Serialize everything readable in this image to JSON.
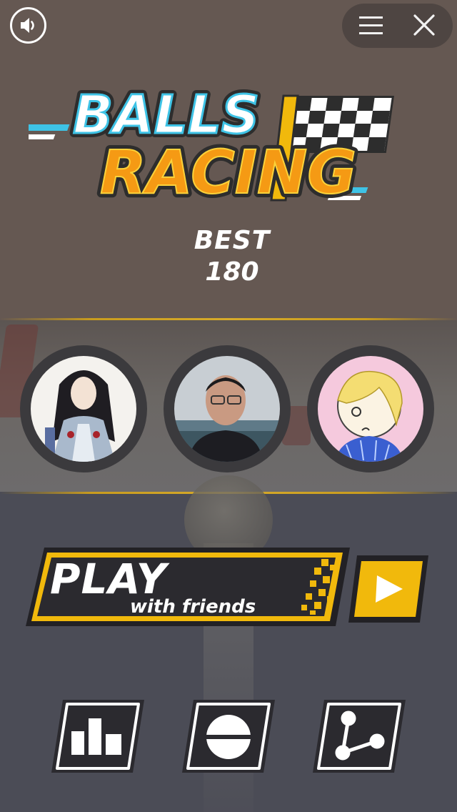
{
  "game": {
    "logo_line1": "BALLS",
    "logo_line2": "RACING"
  },
  "best": {
    "label": "BEST",
    "score": "180"
  },
  "play": {
    "title": "PLAY",
    "subtitle": "with friends"
  },
  "friends": [
    {
      "avatar": "anime-character-avatar"
    },
    {
      "avatar": "man-with-glasses-avatar"
    },
    {
      "avatar": "cartoon-blonde-avatar"
    }
  ],
  "icons": {
    "sound": "speaker-icon",
    "menu": "hamburger-menu-icon",
    "close": "close-icon",
    "play": "play-triangle-icon",
    "leaderboard": "bar-chart-icon",
    "skins": "ball-icon",
    "share": "share-icon"
  },
  "colors": {
    "accent_yellow": "#f1b90c",
    "logo_orange": "#f59a14",
    "logo_cyan": "#3ec3e6",
    "top_bg": "#655852",
    "lower_bg": "#4b4c56"
  }
}
